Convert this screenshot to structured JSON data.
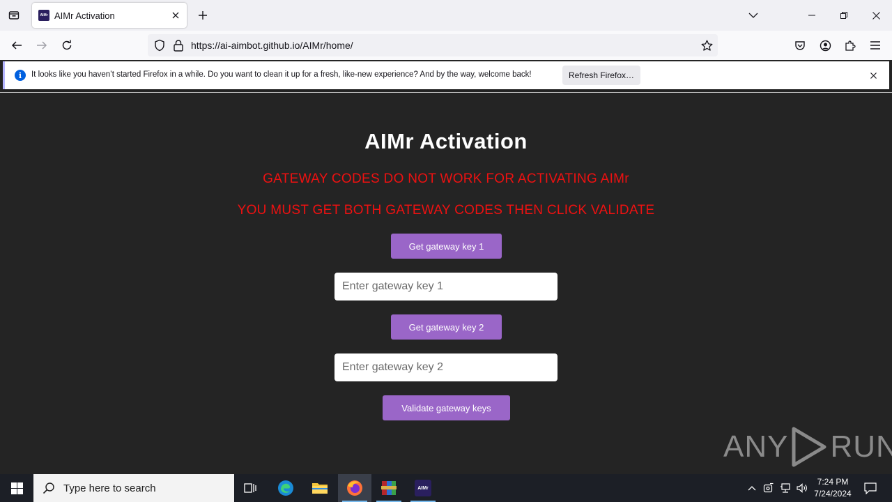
{
  "browser": {
    "tab": {
      "title": "AIMr Activation",
      "favicon_text": "AIMr"
    },
    "url": "https://ai-aimbot.github.io/AIMr/home/",
    "notification": {
      "message": "It looks like you haven’t started Firefox in a while. Do you want to clean it up for a fresh, like-new experience? And by the way, welcome back!",
      "button_label": "Refresh Firefox…"
    }
  },
  "page": {
    "title": "AIMr Activation",
    "warning_1": "GATEWAY CODES DO NOT WORK FOR ACTIVATING AIMr",
    "warning_2": "YOU MUST GET BOTH GATEWAY CODES THEN CLICK VALIDATE",
    "button_key1": "Get gateway key 1",
    "input_key1_placeholder": "Enter gateway key 1",
    "button_key2": "Get gateway key 2",
    "input_key2_placeholder": "Enter gateway key 2",
    "button_validate": "Validate gateway keys"
  },
  "watermark": {
    "left": "ANY",
    "right": "RUN"
  },
  "taskbar": {
    "search_placeholder": "Type here to search",
    "time": "7:24 PM",
    "date": "7/24/2024",
    "app_label": "AIMr"
  },
  "colors": {
    "page_background": "#242424",
    "warning_text": "#ee1111",
    "button_purple": "#9a66c8",
    "taskbar": "#1c1f26"
  }
}
